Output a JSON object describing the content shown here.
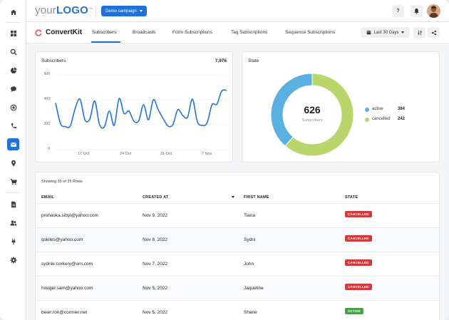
{
  "app": {
    "logo_prefix": "your",
    "logo_main": "LOGO",
    "logo_tm": "TM",
    "campaign_button": "Demo campaign",
    "help_icon_text": "?"
  },
  "nav": {
    "brand": "ConvertKit",
    "tabs": [
      {
        "label": "Subscribers",
        "active": true
      },
      {
        "label": "Broadcasts",
        "active": false
      },
      {
        "label": "Form Subscriptions",
        "active": false
      },
      {
        "label": "Tag Subscriptions",
        "active": false
      },
      {
        "label": "Sequence Subscriptions",
        "active": false
      }
    ],
    "date_range": "Last 30 Days"
  },
  "sidebar": {
    "icons": [
      "home-icon",
      "grid-icon",
      "search-icon",
      "pie-chart-icon",
      "chat-icon",
      "target-icon",
      "phone-icon",
      "mail-icon",
      "location-icon",
      "cart-icon",
      "report-icon",
      "users-icon",
      "plug-icon",
      "gear-icon"
    ],
    "active": "mail-icon"
  },
  "subscribers_card": {
    "title": "Subscribers",
    "total": "7,976"
  },
  "state_card": {
    "title": "State",
    "center_value": "626",
    "center_label": "Subscribers",
    "legend": [
      {
        "label": "active",
        "value": "384",
        "color": "#b8d66a"
      },
      {
        "label": "cancelled",
        "value": "242",
        "color": "#5ab0e0"
      }
    ]
  },
  "chart_data": [
    {
      "type": "line",
      "title": "Subscribers",
      "yticks": [
        "600",
        "400",
        "200",
        "0"
      ],
      "ylim": [
        0,
        600
      ],
      "xticks": [
        "17 Oct",
        "24 Oct",
        "31 Oct",
        "7 Nov"
      ],
      "grid": true,
      "color": "#1f73d8",
      "values": [
        375,
        210,
        185,
        190,
        330,
        405,
        240,
        245,
        390,
        200,
        185,
        310,
        195,
        410,
        290,
        310,
        230,
        230,
        360,
        240,
        400,
        320,
        250,
        190,
        200,
        320,
        275,
        260,
        405,
        225,
        195,
        215,
        360,
        365,
        470,
        475
      ]
    },
    {
      "type": "pie",
      "title": "State",
      "categories": [
        "active",
        "cancelled"
      ],
      "values": [
        384,
        242
      ],
      "colors": [
        "#b8d66a",
        "#5ab0e0"
      ]
    }
  ],
  "table": {
    "rows_info": "Showing 35 of 35 Rows",
    "headers": [
      "EMAIL",
      "CREATED AT",
      "FIRST NAME",
      "STATE"
    ],
    "rows": [
      {
        "email": "prohaska.sibyl@yahoo.com",
        "created": "Nov 9, 2022",
        "name": "Tiana",
        "state": "CANCELLED"
      },
      {
        "email": "qskiles@yahoo.com",
        "created": "Nov 8, 2022",
        "name": "Sydni",
        "state": "CANCELLED"
      },
      {
        "email": "sydnie.corkery@orn.com",
        "created": "Nov 7, 2022",
        "name": "John",
        "state": "CANCELLED"
      },
      {
        "email": "hoeger.sam@yahoo.com",
        "created": "Nov 5, 2022",
        "name": "Jaqueline",
        "state": "CANCELLED"
      },
      {
        "email": "beier.ron@cormier.net",
        "created": "Nov 5, 2022",
        "name": "Shane",
        "state": "ACTIVE"
      }
    ]
  }
}
